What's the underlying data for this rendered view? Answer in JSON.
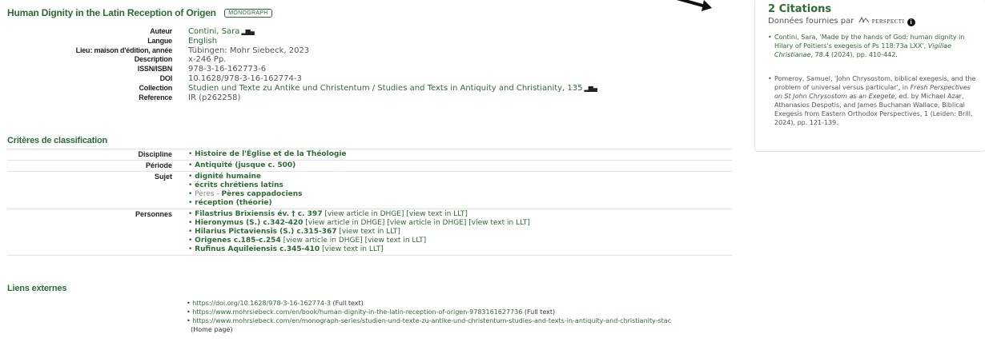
{
  "header": {
    "title": "Human Dignity in the Latin Reception of Origen",
    "badge": "MONOGRAPH"
  },
  "meta": [
    {
      "key": "Auteur",
      "value": "Contini, Sara",
      "link": true,
      "bars": true
    },
    {
      "key": "Langue",
      "value": "English",
      "link": true,
      "bars": false
    },
    {
      "key": "Lieu: maison d'édition, année",
      "value": "Tübingen: Mohr Siebeck, 2023",
      "link": false,
      "bars": false
    },
    {
      "key": "Description",
      "value": "x-246 Pp.",
      "link": false,
      "bars": false
    },
    {
      "key": "ISSN/ISBN",
      "value": "978-3-16-162773-6",
      "link": false,
      "bars": false
    },
    {
      "key": "DOI",
      "value": "10.1628/978-3-16-162774-3",
      "link": false,
      "bars": false
    },
    {
      "key": "Collection",
      "value": "Studien und Texte zu Antike und Christentum / Studies and Texts in Antiquity and Christianity, 135",
      "link": true,
      "bars": true
    },
    {
      "key": "Reference",
      "value": "IR (p262258)",
      "link": false,
      "bars": false
    }
  ],
  "criteria": {
    "heading": "Critères de classification",
    "rows": [
      {
        "key": "Discipline",
        "items": [
          {
            "prefix": "",
            "bold": "Histoire de l'Église et de la Théologie",
            "links": []
          }
        ]
      },
      {
        "key": "Période",
        "items": [
          {
            "prefix": "",
            "bold": "Antiquité (jusque c. 500)",
            "links": []
          }
        ]
      },
      {
        "key": "Sujet",
        "items": [
          {
            "prefix": "",
            "bold": "dignité humaine",
            "links": []
          },
          {
            "prefix": "",
            "bold": "écrits chrétiens latins",
            "links": []
          },
          {
            "prefix": "Pères - ",
            "bold": "Pères cappadociens",
            "links": []
          },
          {
            "prefix": "",
            "bold": "réception (théorie)",
            "links": []
          }
        ]
      },
      {
        "key": "Personnes",
        "items": [
          {
            "prefix": "",
            "bold": "Filastrius Brixiensis év. † c. 397",
            "links": [
              "[view article in DHGE]",
              "[view text in LLT]"
            ]
          },
          {
            "prefix": "",
            "bold": "Hieronymus (S.) c.342-420",
            "links": [
              "[view article in DHGE]",
              "[view article in DHGE]",
              "[view text in LLT]"
            ]
          },
          {
            "prefix": "",
            "bold": "Hilarius Pictaviensis (S.) c.315-367",
            "links": [
              "[view text in LLT]"
            ]
          },
          {
            "prefix": "",
            "bold": "Origenes c.185-c.254",
            "links": [
              "[view article in DHGE]",
              "[view text in LLT]"
            ]
          },
          {
            "prefix": "",
            "bold": "Rufinus Aquileiensis c.345-410",
            "links": [
              "[view text in LLT]"
            ]
          }
        ]
      }
    ]
  },
  "external": {
    "heading": "Liens externes",
    "links": [
      {
        "url": "https://doi.org/10.1628/978-3-16-162774-3",
        "note": "(Full text)"
      },
      {
        "url": "https://www.mohrsiebeck.com/en/book/human-dignity-in-the-latin-reception-of-origen-9783161627736",
        "note": "(Full text)"
      },
      {
        "url": "https://www.mohrsiebeck.com/en/monograph-series/studien-und-texte-zu-antike-und-christentum-studies-and-texts-in-antiquity-and-christianity-stac",
        "note": "(Home page)"
      }
    ]
  },
  "citations": {
    "title": "2 Citations",
    "provider_prefix": "Données fournies par",
    "provider": "PERSPECTI",
    "items": [
      {
        "text_before": "Contini, Sara, 'Made by the hands of God: human dignity in Hilary of Poitiers's exegesis of Ps 118:73a LXX', ",
        "italic": "Vigiliae Christianae",
        "text_after": ", 78.4 (2024), pp. 410-442."
      },
      {
        "text_before": "Pomeroy, Samuel, 'John Chrysostom, biblical exegesis, and the problem of universal versus particular', in ",
        "italic": "Fresh Perspectives on St John Chrysostom as an Exegete",
        "text_after": ", ed. by Michael Azar, Athanasios Despotis, and James Buchanan Wallace, Biblical Exegesis from Eastern Orthodox Perspectives, 1 (Leiden: Brill, 2024), pp. 121-139."
      }
    ]
  },
  "colors": {
    "accent": "#2e6b33",
    "border": "#e4e4e4"
  }
}
